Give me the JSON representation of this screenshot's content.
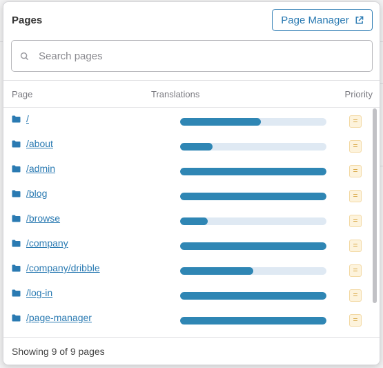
{
  "panel": {
    "title": "Pages",
    "page_manager_label": "Page Manager",
    "search_placeholder": "Search pages",
    "search_value": ""
  },
  "columns": {
    "page": "Page",
    "translations": "Translations",
    "priority": "Priority"
  },
  "pages": [
    {
      "path": "/",
      "translation_progress": 0.55,
      "priority_icon": "equals-icon"
    },
    {
      "path": "/about",
      "translation_progress": 0.22,
      "priority_icon": "equals-icon"
    },
    {
      "path": "/admin",
      "translation_progress": 1.0,
      "priority_icon": "equals-icon"
    },
    {
      "path": "/blog",
      "translation_progress": 1.0,
      "priority_icon": "equals-icon"
    },
    {
      "path": "/browse",
      "translation_progress": 0.19,
      "priority_icon": "equals-icon"
    },
    {
      "path": "/company",
      "translation_progress": 1.0,
      "priority_icon": "equals-icon"
    },
    {
      "path": "/company/dribble",
      "translation_progress": 0.5,
      "priority_icon": "equals-icon"
    },
    {
      "path": "/log-in",
      "translation_progress": 1.0,
      "priority_icon": "equals-icon"
    },
    {
      "path": "/page-manager",
      "translation_progress": 1.0,
      "priority_icon": "equals-icon"
    }
  ],
  "footer": {
    "status": "Showing 9 of 9 pages"
  },
  "colors": {
    "accent": "#2a7ab2",
    "bar_fill": "#2f86b4",
    "bar_track": "#dfe9f3",
    "priority_bg": "#fdf3dc",
    "priority_fg": "#d6a23a"
  }
}
